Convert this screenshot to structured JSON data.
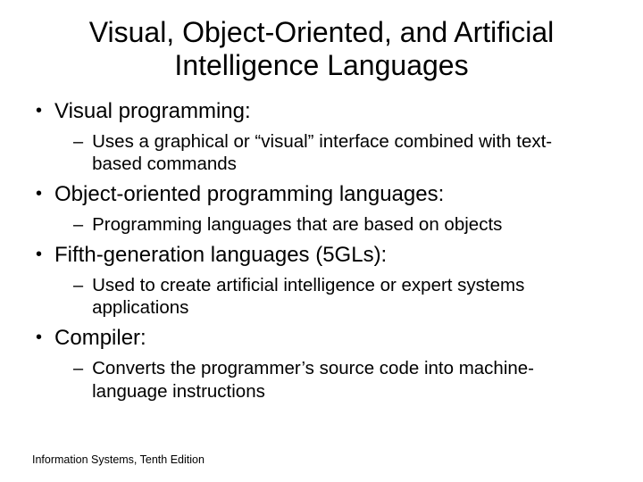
{
  "slide": {
    "title": "Visual, Object-Oriented, and Artificial Intelligence Languages",
    "bullets": [
      {
        "text": "Visual programming:",
        "sub": [
          "Uses a graphical or “visual” interface combined with text-based commands"
        ]
      },
      {
        "text": "Object-oriented programming languages:",
        "sub": [
          "Programming languages that are based on objects"
        ]
      },
      {
        "text": "Fifth-generation languages (5GLs):",
        "sub": [
          "Used to create artificial intelligence or expert systems applications"
        ]
      },
      {
        "text": "Compiler:",
        "sub": [
          "Converts the programmer’s source code into machine-language instructions"
        ]
      }
    ],
    "footer": "Information Systems, Tenth Edition"
  }
}
